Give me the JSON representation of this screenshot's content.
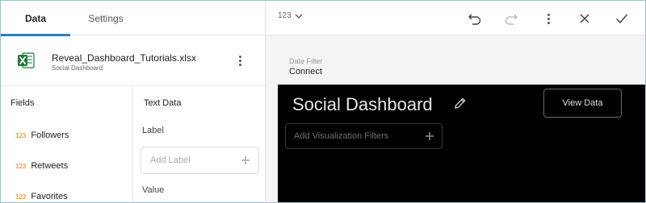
{
  "tabs": [
    {
      "label": "Data"
    },
    {
      "label": "Settings"
    }
  ],
  "file": {
    "name": "Reveal_Dashboard_Tutorials.xlsx",
    "subtitle": "Social Dashboard",
    "icon": "excel-icon",
    "icon_color": "#1f7a3d"
  },
  "fields": {
    "title": "Fields",
    "items": [
      {
        "type": "123",
        "label": "Followers"
      },
      {
        "type": "123",
        "label": "Retweets"
      },
      {
        "type": "123",
        "label": "Favorites"
      }
    ]
  },
  "text_data": {
    "title": "Text Data",
    "label_heading": "Label",
    "label_placeholder": "Add Label",
    "value_heading": "Value"
  },
  "toolbar": {
    "zoom_label": "123",
    "icons": [
      "chevron-down-icon",
      "undo-icon",
      "redo-icon",
      "more-icon",
      "close-icon",
      "check-icon"
    ]
  },
  "date_filter": {
    "label": "Date Filter",
    "value": "Connect"
  },
  "dashboard": {
    "title": "Social Dashboard",
    "view_data_label": "View Data",
    "viz_filter_placeholder": "Add Visualization Filters"
  },
  "colors": {
    "accent": "#2d7fc1",
    "number_type": "#e8a33d",
    "canvas_bg": "#000000"
  }
}
